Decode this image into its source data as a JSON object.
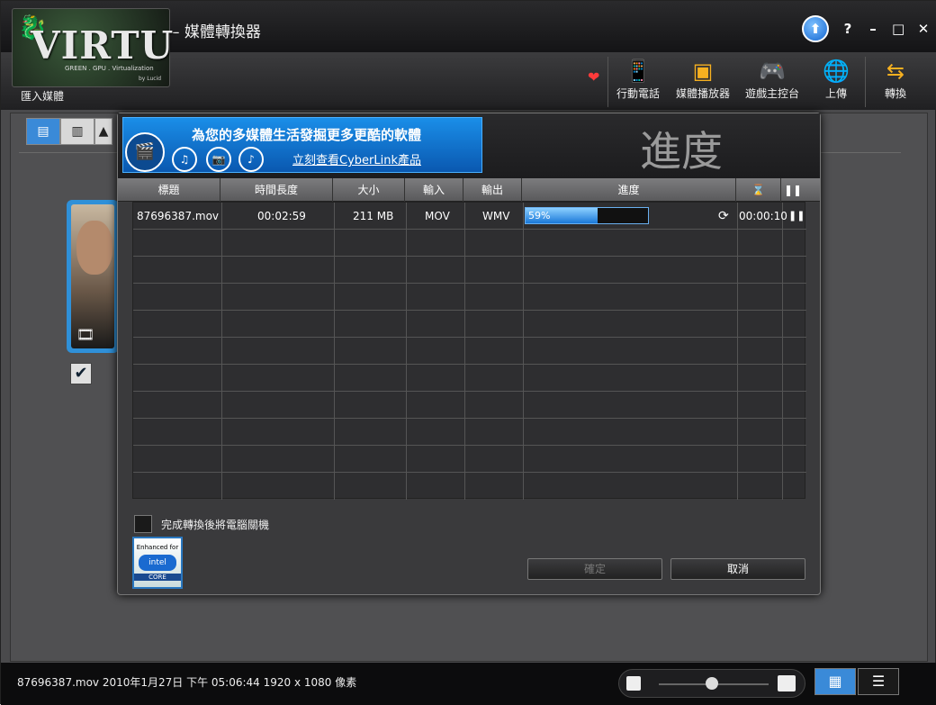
{
  "app": {
    "title": "– 媒體轉換器",
    "logo_text": "VIRTU",
    "logo_sub": "GREEN . GPU . Virtualization",
    "logo_by": "by Lucid",
    "import_label": "匯入媒體"
  },
  "window_buttons": {
    "update": "⬆",
    "help": "?",
    "minimize": "–",
    "maximize": "□",
    "close": "✕"
  },
  "toolbar": [
    {
      "label": "行動電話",
      "icon": "mobile-phone-icon"
    },
    {
      "label": "媒體播放器",
      "icon": "media-player-icon"
    },
    {
      "label": "遊戲主控台",
      "icon": "game-console-icon"
    },
    {
      "label": "上傳",
      "icon": "globe-upload-icon"
    },
    {
      "label": "轉換",
      "icon": "convert-arrows-icon"
    }
  ],
  "dialog": {
    "title": "進度",
    "banner_headline": "為您的多媒體生活發掘更多更酷的軟體",
    "banner_link": "立刻查看CyberLink產品",
    "columns": {
      "title": "標題",
      "duration": "時間長度",
      "size": "大小",
      "input": "輸入",
      "output": "輸出",
      "progress": "進度"
    },
    "rows": [
      {
        "title": "87696387.mov",
        "duration": "00:02:59",
        "size": "211 MB",
        "input": "MOV",
        "output": "WMV",
        "progress": "59%",
        "progress_value": 59,
        "time": "00:00:10"
      }
    ],
    "shutdown_label": "完成轉換後將電腦關機",
    "ok_label": "確定",
    "cancel_label": "取消",
    "intel_badge": {
      "line1": "Enhanced for",
      "logo": "intel",
      "line3": "CORE"
    }
  },
  "status_text": "87696387.mov 2010年1月27日 下午 05:06:44 1920 x 1080 像素",
  "colors": {
    "accent": "#3a8ad8",
    "progress": "#1a78d8",
    "heart": "#ff3b3b"
  }
}
